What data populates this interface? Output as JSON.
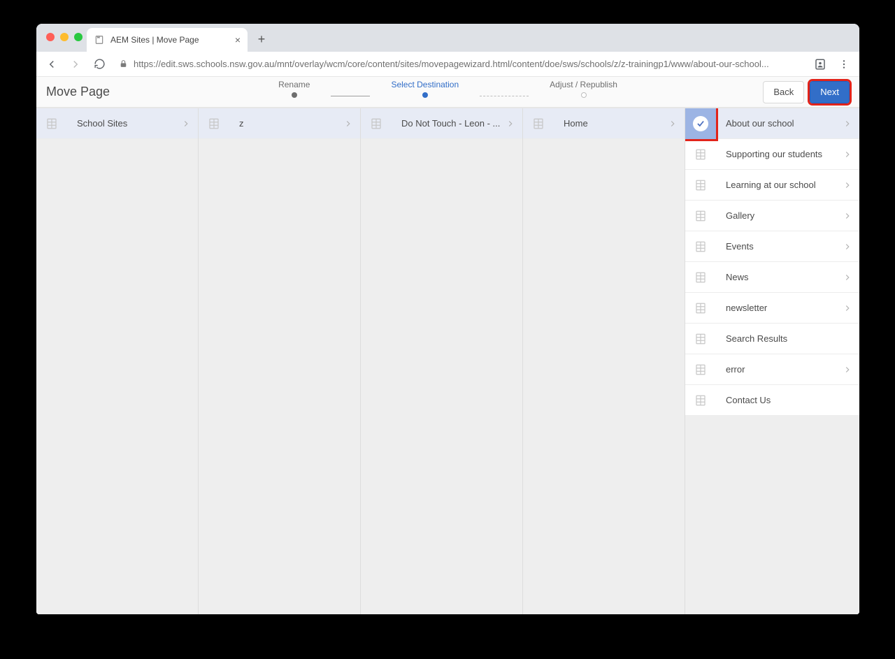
{
  "browser": {
    "tab_title": "AEM Sites | Move Page",
    "url_display": "https://edit.sws.schools.nsw.gov.au/mnt/overlay/wcm/core/content/sites/movepagewizard.html/content/doe/sws/schools/z/z-trainingp1/www/about-our-school..."
  },
  "wizard": {
    "title": "Move Page",
    "steps": [
      "Rename",
      "Select Destination",
      "Adjust / Republish"
    ],
    "active_step_index": 1,
    "back_label": "Back",
    "next_label": "Next"
  },
  "columns": [
    {
      "items": [
        {
          "label": "School Sites",
          "has_children": true,
          "selected": true
        }
      ]
    },
    {
      "items": [
        {
          "label": "z",
          "has_children": true,
          "selected": true
        }
      ]
    },
    {
      "items": [
        {
          "label": "Do Not Touch - Leon - ...",
          "has_children": true,
          "selected": true
        }
      ]
    },
    {
      "items": [
        {
          "label": "Home",
          "has_children": true,
          "selected": true
        }
      ]
    },
    {
      "items": [
        {
          "label": "About our school",
          "has_children": true,
          "checked": true,
          "highlighted": true
        },
        {
          "label": "Supporting our students",
          "has_children": true
        },
        {
          "label": "Learning at our school",
          "has_children": true
        },
        {
          "label": "Gallery",
          "has_children": true
        },
        {
          "label": "Events",
          "has_children": true
        },
        {
          "label": "News",
          "has_children": true
        },
        {
          "label": "newsletter",
          "has_children": true
        },
        {
          "label": "Search Results",
          "has_children": false
        },
        {
          "label": "error",
          "has_children": true
        },
        {
          "label": "Contact Us",
          "has_children": false
        }
      ]
    }
  ]
}
